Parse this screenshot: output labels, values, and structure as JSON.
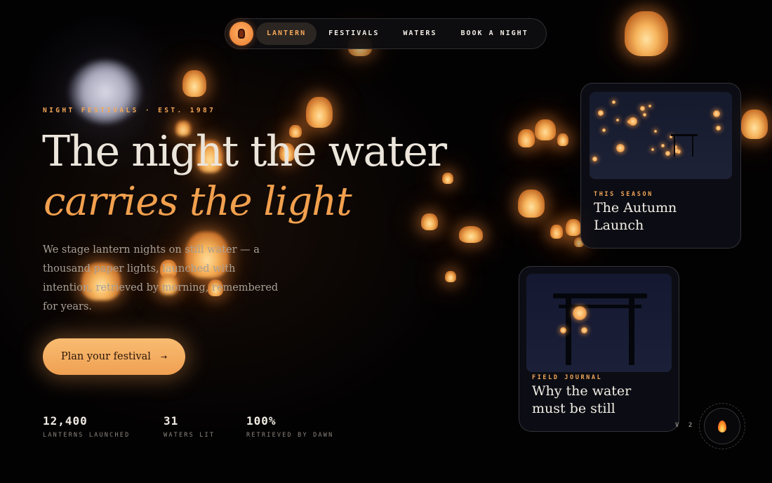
{
  "nav": {
    "logo_icon": "lantern-icon",
    "items": [
      {
        "label": "LANTERN",
        "active": true
      },
      {
        "label": "FESTIVALS",
        "active": false
      },
      {
        "label": "WATERS",
        "active": false
      },
      {
        "label": "BOOK A NIGHT",
        "active": false
      }
    ]
  },
  "hero": {
    "eyebrow": "NIGHT FESTIVALS · EST. 1987",
    "headline_line1": "The night the water",
    "headline_line2": "carries the light",
    "lede": "We stage lantern nights on still water — a thousand paper lights, launched with intention, retrieved by morning, remembered for years.",
    "cta_label": "Plan your festival",
    "cta_arrow": "→"
  },
  "stats": [
    {
      "value": "12,400",
      "label": "LANTERNS LAUNCHED"
    },
    {
      "value": "31",
      "label": "WATERS LIT"
    },
    {
      "value": "100%",
      "label": "RETRIEVED BY DAWN"
    }
  ],
  "cards": [
    {
      "kicker": "THIS SEASON",
      "title": "The Autumn Launch"
    },
    {
      "kicker": "FIELD JOURNAL",
      "title": "Why the water must be still"
    }
  ],
  "version": "V 2",
  "flame_button_icon": "flame-icon",
  "colors": {
    "background": "#030203",
    "accent": "#f3a657",
    "headline_accent": "#f2a04e",
    "cta": "#f5ad62"
  }
}
